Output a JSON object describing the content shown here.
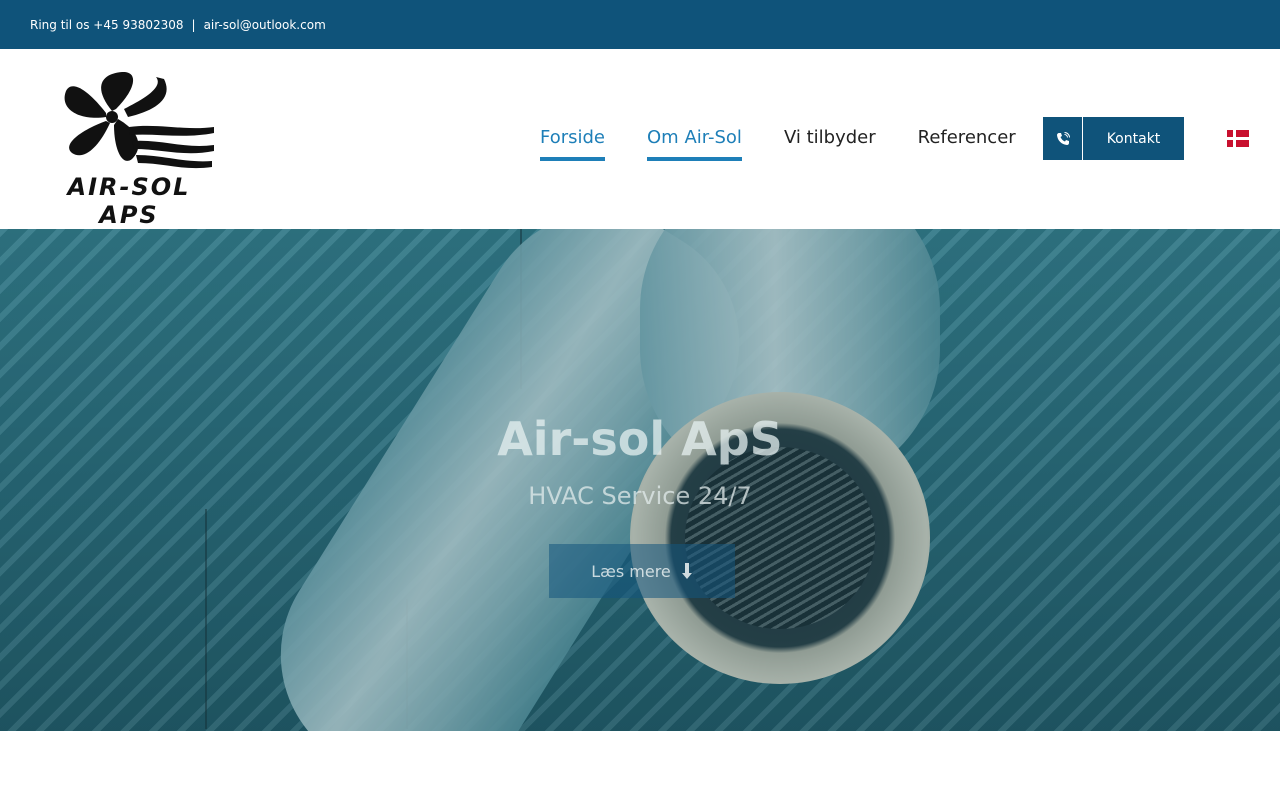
{
  "topbar": {
    "phone_text": "Ring til os +45 93802308",
    "separator": "|",
    "email": "air-sol@outlook.com"
  },
  "header": {
    "logo_text": "AIR-SOL APS",
    "logo_icon": "fan-icon",
    "nav": [
      {
        "label": "Forside",
        "active": true
      },
      {
        "label": "Om Air-Sol",
        "active": true
      },
      {
        "label": "Vi tilbyder",
        "active": false
      },
      {
        "label": "Referencer",
        "active": false
      }
    ],
    "contact_button": {
      "icon": "phone-icon",
      "label": "Kontakt"
    },
    "language_flag": "denmark-flag-icon"
  },
  "hero": {
    "title": "Air-sol ApS",
    "subtitle": "HVAC Service 24/7",
    "button_label": "Læs mere",
    "button_icon": "arrow-down-icon"
  },
  "colors": {
    "primary": "#0f537a",
    "accent": "#1e7fb8"
  }
}
